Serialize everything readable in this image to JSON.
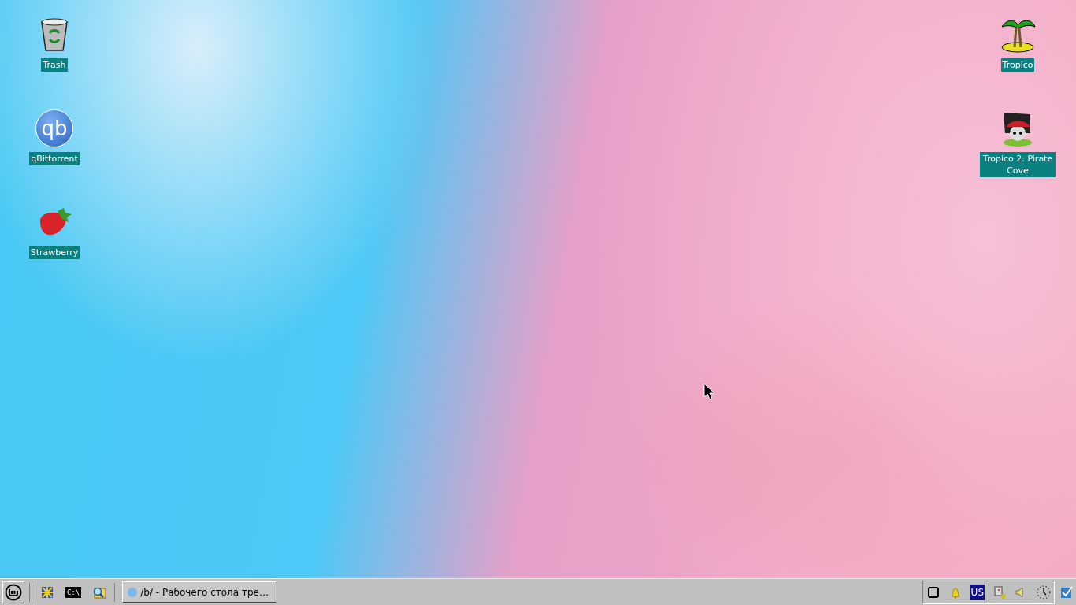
{
  "desktop": {
    "left_icons": [
      {
        "kind": "trash",
        "label": "Trash"
      },
      {
        "kind": "qbittorrent",
        "label": "qBittorrent",
        "logo_text": "qb"
      },
      {
        "kind": "strawberry",
        "label": "Strawberry"
      }
    ],
    "right_icons": [
      {
        "kind": "palm",
        "label": "Tropico"
      },
      {
        "kind": "pirate",
        "label": "Tropico 2: Pirate Cove"
      }
    ]
  },
  "taskbar": {
    "quick_launch": [
      {
        "kind": "puzzle"
      },
      {
        "kind": "terminal",
        "text": "C:\\"
      },
      {
        "kind": "search-folder"
      }
    ],
    "tasks": [
      {
        "title": "/b/ - Рабочего стола тре…"
      }
    ],
    "tray": {
      "layout": "US"
    }
  }
}
